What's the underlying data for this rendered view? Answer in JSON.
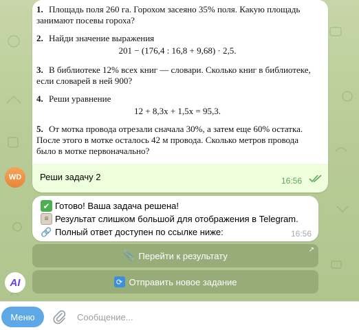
{
  "chat": {
    "outgoing": {
      "avatar_initials": "WD",
      "caption": "Реши задачу 2",
      "time": "16:56",
      "homework": {
        "tasks": [
          {
            "num": "1.",
            "text": "Площадь поля 260 га. Горохом засеяно 35% поля. Какую площадь занимают посевы гороха?"
          },
          {
            "num": "2.",
            "text": "Найди значение выражения",
            "equation": "201 − (176,4 : 16,8 + 9,68) · 2,5."
          },
          {
            "num": "3.",
            "text": "В библиотеке 12% всех книг — словари. Сколько книг в библиотеке, если словарей в ней 900?"
          },
          {
            "num": "4.",
            "text": "Реши уравнение",
            "equation": "12 + 8,3x + 1,5x = 95,3."
          },
          {
            "num": "5.",
            "text": "От мотка провода отрезали сначала 30%, а затем еще 60% остатка. После этого в мотке осталось 42 м провода. Сколько метров провода было в мотке первоначально?"
          }
        ]
      }
    },
    "incoming": {
      "line1": "Готово! Ваша задача решена!",
      "line2": "Результат слишком большой для отображения в Telegram.",
      "line3": "Полный ответ доступен по ссылке ниже:",
      "time": "16:56",
      "bot_avatar": "AI"
    },
    "buttons": {
      "open_result": "Перейти к результату",
      "new_task": "Отправить новое задание"
    }
  },
  "composer": {
    "menu_label": "Меню",
    "placeholder": "Сообщение..."
  },
  "colors": {
    "outgoing_bubble": "#effedd",
    "menu_button": "#5ea8e5",
    "read_check": "#5fa55a"
  }
}
